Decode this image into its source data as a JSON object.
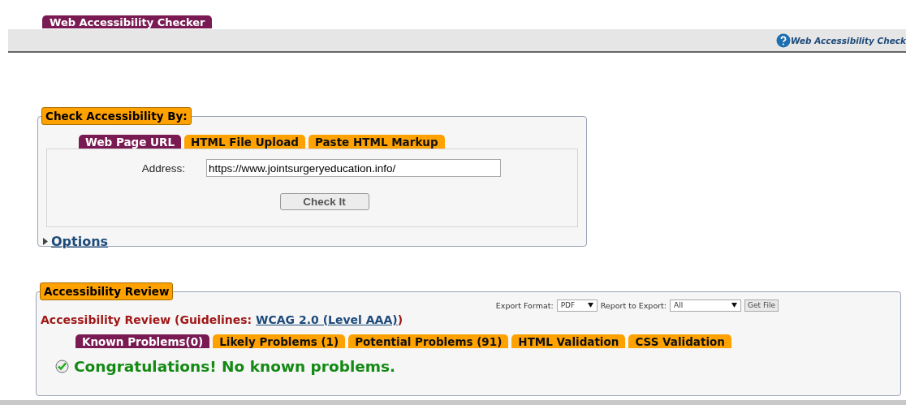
{
  "header": {
    "title_tab": "Web Accessibility Checker",
    "help_link": "Web Accessibility Check"
  },
  "check_panel": {
    "legend": "Check Accessibility By:",
    "tabs": [
      {
        "label": "Web Page URL",
        "selected": true
      },
      {
        "label": "HTML File Upload",
        "selected": false
      },
      {
        "label": "Paste HTML Markup",
        "selected": false
      }
    ],
    "address_label": "Address:",
    "address_value": "https://www.jointsurgeryeducation.info/",
    "check_button": "Check It",
    "options": {
      "label": "Options",
      "expanded": false
    }
  },
  "review_panel": {
    "legend": "Accessibility Review",
    "export_format_label": "Export Format:",
    "export_format": "PDF",
    "report_label": "Report to Export:",
    "report": "All",
    "get_file_button": "Get File",
    "heading": "Accessibility Review (Guidelines: ",
    "guideline_link": "WCAG 2.0 (Level AAA)",
    "heading_end": ")",
    "tabs": [
      {
        "label": "Known Problems(0)",
        "selected": true
      },
      {
        "label": "Likely Problems (1)",
        "selected": false
      },
      {
        "label": "Potential Problems (91)",
        "selected": false
      },
      {
        "label": "HTML Validation",
        "selected": false
      },
      {
        "label": "CSS Validation",
        "selected": false
      }
    ],
    "message": "Congratulations! No known problems."
  }
}
